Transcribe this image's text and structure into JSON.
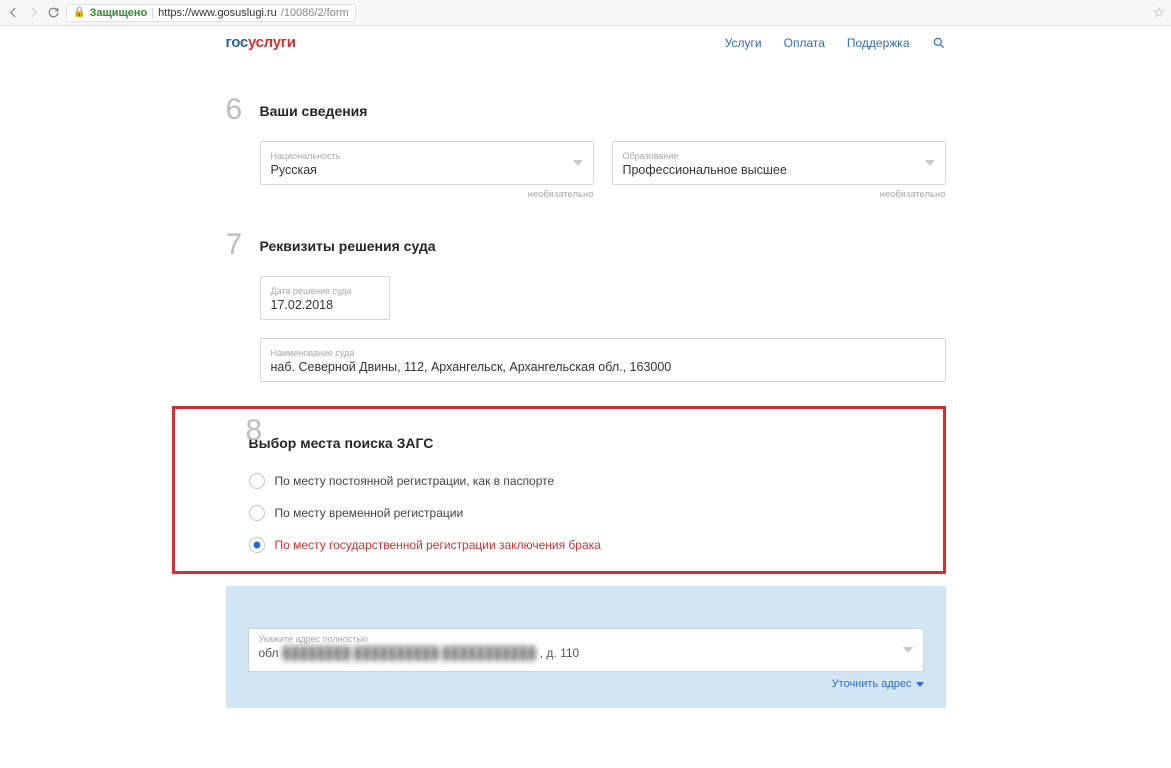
{
  "browser": {
    "secure_label": "Защищено",
    "url_host": "https://www.gosuslugi.ru",
    "url_path": "/10086/2/form"
  },
  "logo": {
    "part1": "гос",
    "part2": "услуги"
  },
  "nav": {
    "services": "Услуги",
    "payment": "Оплата",
    "support": "Поддержка"
  },
  "section6": {
    "num": "6",
    "title": "Ваши сведения",
    "nationality": {
      "label": "Национальность",
      "value": "Русская",
      "hint": "необязательно"
    },
    "education": {
      "label": "Образование",
      "value": "Профессиональное высшее",
      "hint": "необязательно"
    }
  },
  "section7": {
    "num": "7",
    "title": "Реквизиты решения суда",
    "date": {
      "label": "Дата решения суда",
      "value": "17.02.2018"
    },
    "court": {
      "label": "Наименование суда",
      "value": "наб. Северной Двины, 112, Архангельск, Архангельская обл., 163000"
    }
  },
  "section8": {
    "num": "8",
    "title": "Выбор места поиска ЗАГС",
    "opt1": "По месту постоянной регистрации, как в паспорте",
    "opt2": "По месту временной регистрации",
    "opt3": "По месту государственной регистрации заключения брака"
  },
  "address": {
    "label": "Укажите адрес полностью",
    "prefix": "обл",
    "blurred": "████████  ██████████  ███████████",
    "suffix": ", д. 110",
    "refine": "Уточнить адрес"
  }
}
